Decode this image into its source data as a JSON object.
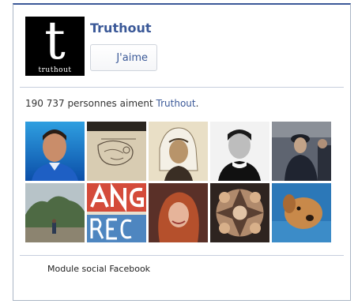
{
  "page": {
    "name": "Truthout",
    "logo": {
      "glyph": "t",
      "wordmark": "truthout"
    },
    "like_button": {
      "label": "J'aime"
    }
  },
  "fans": {
    "count_text": "190 737 personnes aiment",
    "page_link": "Truthout",
    "trailing": ".",
    "thumbnails": [
      {
        "id": "fan-1",
        "alt": "Man in blue shirt"
      },
      {
        "id": "fan-2",
        "alt": "Pencil sketch"
      },
      {
        "id": "fan-3",
        "alt": "Man in headscarf, sepia"
      },
      {
        "id": "fan-4",
        "alt": "Black and white portrait"
      },
      {
        "id": "fan-5",
        "alt": "Police officers"
      },
      {
        "id": "fan-6",
        "alt": "Person on road near hills"
      },
      {
        "id": "fan-7",
        "alt": "Graffiti lettering"
      },
      {
        "id": "fan-8",
        "alt": "Woman with red hair"
      },
      {
        "id": "fan-9",
        "alt": "Kaleidoscope pattern"
      },
      {
        "id": "fan-10",
        "alt": "Golden dog"
      }
    ]
  },
  "footer": {
    "label": "Module social Facebook"
  },
  "colors": {
    "brand": "#3b5998",
    "divider": "#c6cede",
    "border": "#aab5c4"
  }
}
